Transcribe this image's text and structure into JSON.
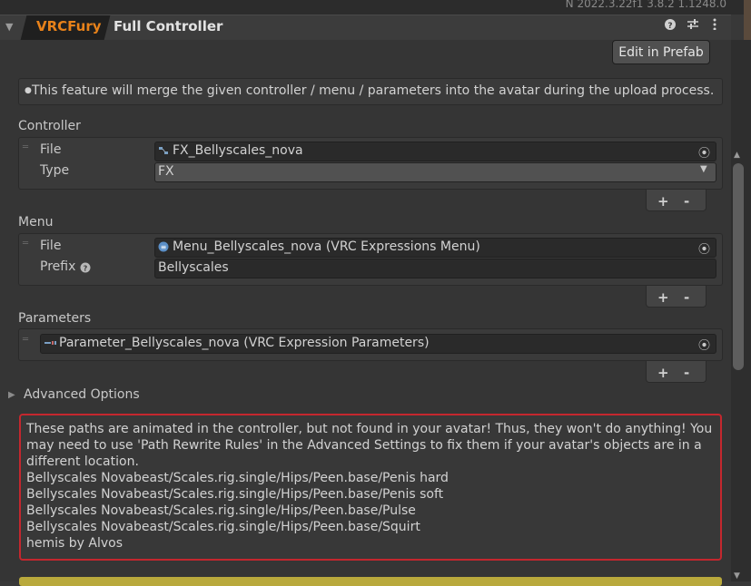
{
  "version_text": "N 2022.3.22f1 3.8.2 1.1248.0",
  "header": {
    "brand": "VRCFury",
    "title": "Full Controller"
  },
  "prefab_button": "Edit in Prefab",
  "info_text": "This feature will merge the given controller / menu / parameters into the avatar during the upload process.",
  "controller": {
    "label": "Controller",
    "file_label": "File",
    "file_value": "FX_Bellyscales_nova",
    "type_label": "Type",
    "type_value": "FX"
  },
  "menu": {
    "label": "Menu",
    "file_label": "File",
    "file_value": "Menu_Bellyscales_nova (VRC Expressions Menu)",
    "prefix_label": "Prefix",
    "prefix_value": "Bellyscales"
  },
  "parameters": {
    "label": "Parameters",
    "file_value": "Parameter_Bellyscales_nova (VRC Expression Parameters)"
  },
  "list_buttons": {
    "add": "+",
    "remove": "-"
  },
  "advanced": {
    "label": "Advanced Options"
  },
  "warning": {
    "lines": [
      "These paths are animated in the controller, but not found in your avatar! Thus, they won't do anything! You",
      "may need to use 'Path Rewrite Rules' in the Advanced Settings to fix them if your avatar's objects are in a",
      "different location.",
      "Bellyscales Novabeast/Scales.rig.single/Hips/Peen.base/Penis hard",
      "Bellyscales Novabeast/Scales.rig.single/Hips/Peen.base/Penis soft",
      "Bellyscales Novabeast/Scales.rig.single/Hips/Peen.base/Pulse",
      "Bellyscales Novabeast/Scales.rig.single/Hips/Peen.base/Squirt",
      "hemis by Alvos"
    ]
  },
  "icons": {
    "fold": "triangle-down-icon",
    "help": "help-icon",
    "settings": "preset-sliders-icon",
    "menu": "kebab-menu-icon",
    "picker": "object-picker-icon",
    "dropdown": "chevron-down-icon"
  },
  "colors": {
    "brand": "#e8821a",
    "warning_border": "#c4272e",
    "yellow_bar": "#b9a93c"
  }
}
